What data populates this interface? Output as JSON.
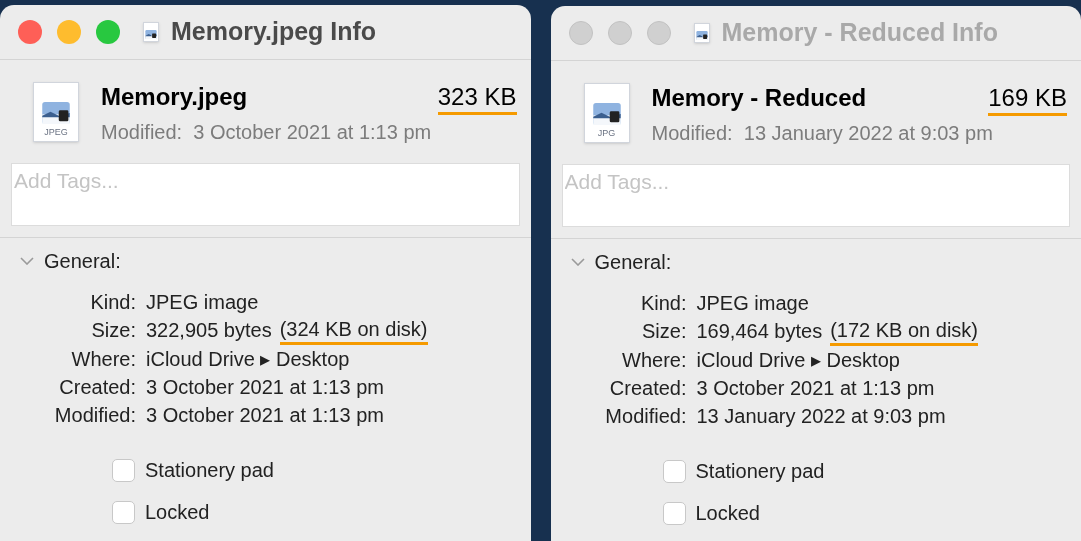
{
  "windows": [
    {
      "active": true,
      "title": "Memory.jpeg Info",
      "file": {
        "name": "Memory.jpeg",
        "icon_label": "JPEG",
        "size": {
          "text": "323 KB",
          "underlined": true
        },
        "modified": "Modified:  3 October 2021 at 1:13 pm"
      },
      "tags": {
        "placeholder": "Add Tags..."
      },
      "general": {
        "title": "General:",
        "expanded": true,
        "rows": [
          {
            "label": "Kind:",
            "value": "JPEG image"
          },
          {
            "label": "Size:",
            "value": "322,905 bytes",
            "note": {
              "text": "(324 KB on disk)",
              "underlined": true
            }
          },
          {
            "label": "Where:",
            "value": "iCloud Drive ▸ Desktop"
          },
          {
            "label": "Created:",
            "value": "3 October 2021 at 1:13 pm"
          },
          {
            "label": "Modified:",
            "value": "3 October 2021 at 1:13 pm"
          }
        ],
        "checkboxes": [
          {
            "label": "Stationery pad",
            "checked": false
          },
          {
            "label": "Locked",
            "checked": false
          }
        ]
      }
    },
    {
      "active": false,
      "title": "Memory - Reduced Info",
      "file": {
        "name": "Memory - Reduced",
        "icon_label": "JPG",
        "size": {
          "text": "169 KB",
          "underlined": true
        },
        "modified": "Modified:  13 January 2022 at 9:03 pm"
      },
      "tags": {
        "placeholder": "Add Tags..."
      },
      "general": {
        "title": "General:",
        "expanded": true,
        "rows": [
          {
            "label": "Kind:",
            "value": "JPEG image"
          },
          {
            "label": "Size:",
            "value": "169,464 bytes",
            "note": {
              "text": "(172 KB on disk)",
              "underlined": true
            }
          },
          {
            "label": "Where:",
            "value": "iCloud Drive ▸ Desktop"
          },
          {
            "label": "Created:",
            "value": "3 October 2021 at 1:13 pm"
          },
          {
            "label": "Modified:",
            "value": "13 January 2022 at 9:03 pm"
          }
        ],
        "checkboxes": [
          {
            "label": "Stationery pad",
            "checked": false
          },
          {
            "label": "Locked",
            "checked": false
          }
        ]
      }
    }
  ]
}
